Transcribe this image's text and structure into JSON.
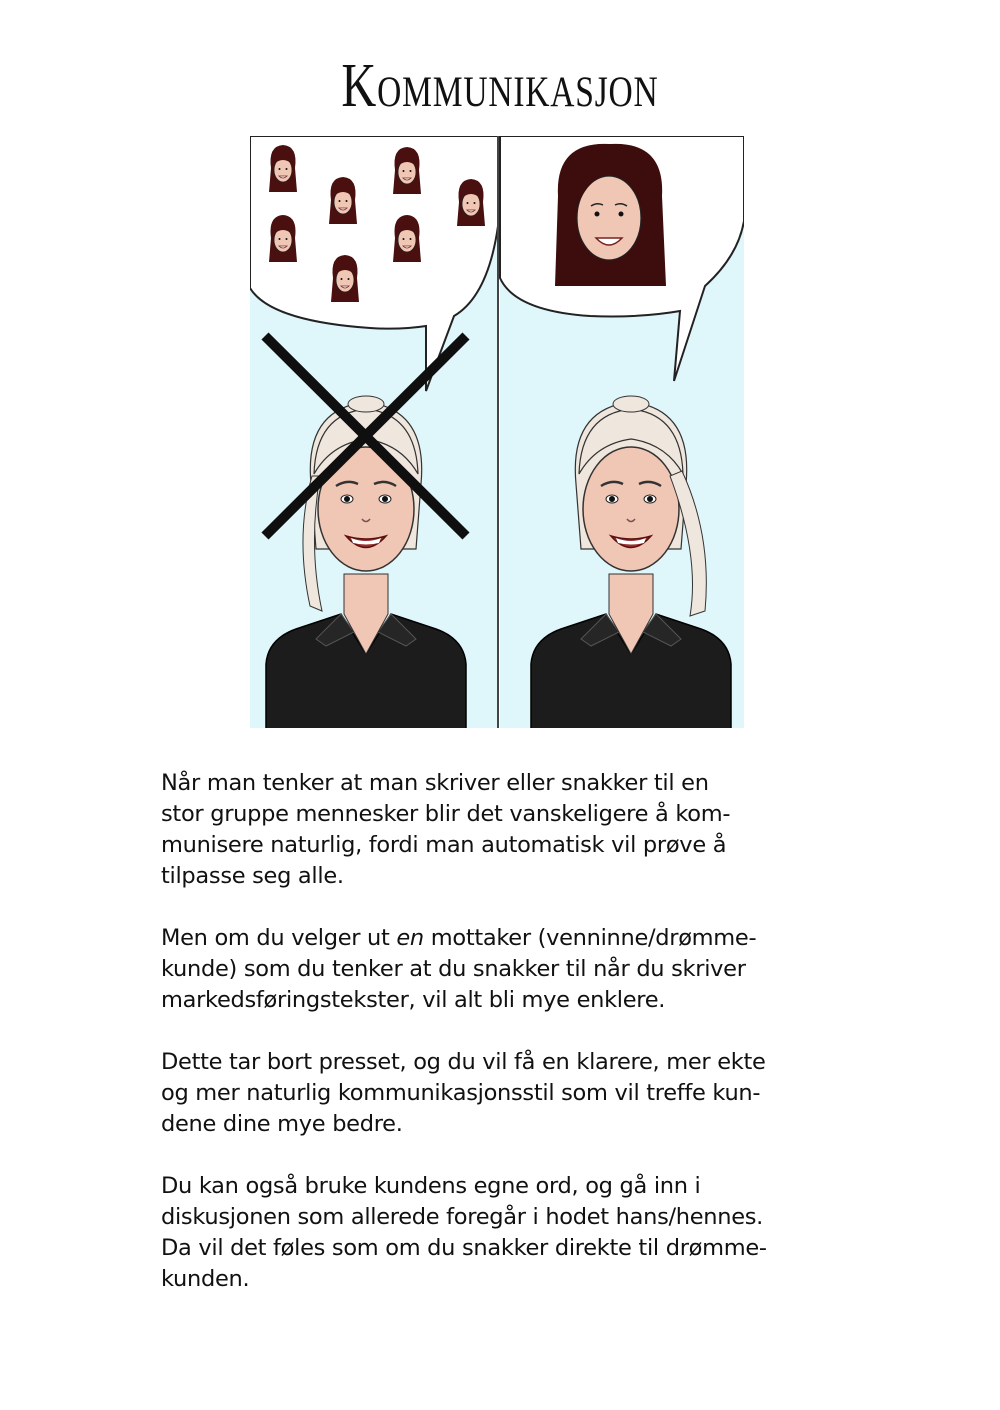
{
  "page": {
    "title": "Kommunikasjon"
  },
  "paragraphs": [
    {
      "lines": [
        "Når man tenker at man skriver eller snakker til en",
        "stor gruppe mennesker blir det vanskeligere å kom-",
        "munisere naturlig, fordi man automatisk vil prøve å",
        "tilpasse seg alle."
      ]
    },
    {
      "line1_before": "Men om du velger ut ",
      "line1_em": "en",
      "line1_after": " mottaker (venninne/drømme-",
      "lines": [
        "kunde) som du tenker at du snakker til når du skriver",
        "markedsføringstekster, vil alt bli mye enklere."
      ]
    },
    {
      "lines": [
        "Dette tar bort presset, og du vil få en klarere, mer ekte",
        "og mer naturlig kommunikasjonsstil som vil treffe kun-",
        "dene dine mye bedre."
      ]
    },
    {
      "lines": [
        "Du kan også bruke kundens egne ord, og gå inn i",
        "diskusjonen som allerede foregår i hodet hans/hennes.",
        "Da vil det føles som om du snakker direkte til drømme-",
        "kunden."
      ]
    }
  ],
  "illustration": {
    "panels": [
      "many-customers-crossed-out",
      "one-dream-customer"
    ],
    "colors": {
      "background": "#dff6fb",
      "skin": "#f0c6b4",
      "blonde_hair": "#efe6de",
      "dark_hair": "#3d0c0c",
      "shirt": "#1c1c1c",
      "cross": "#0f0f0f"
    }
  }
}
